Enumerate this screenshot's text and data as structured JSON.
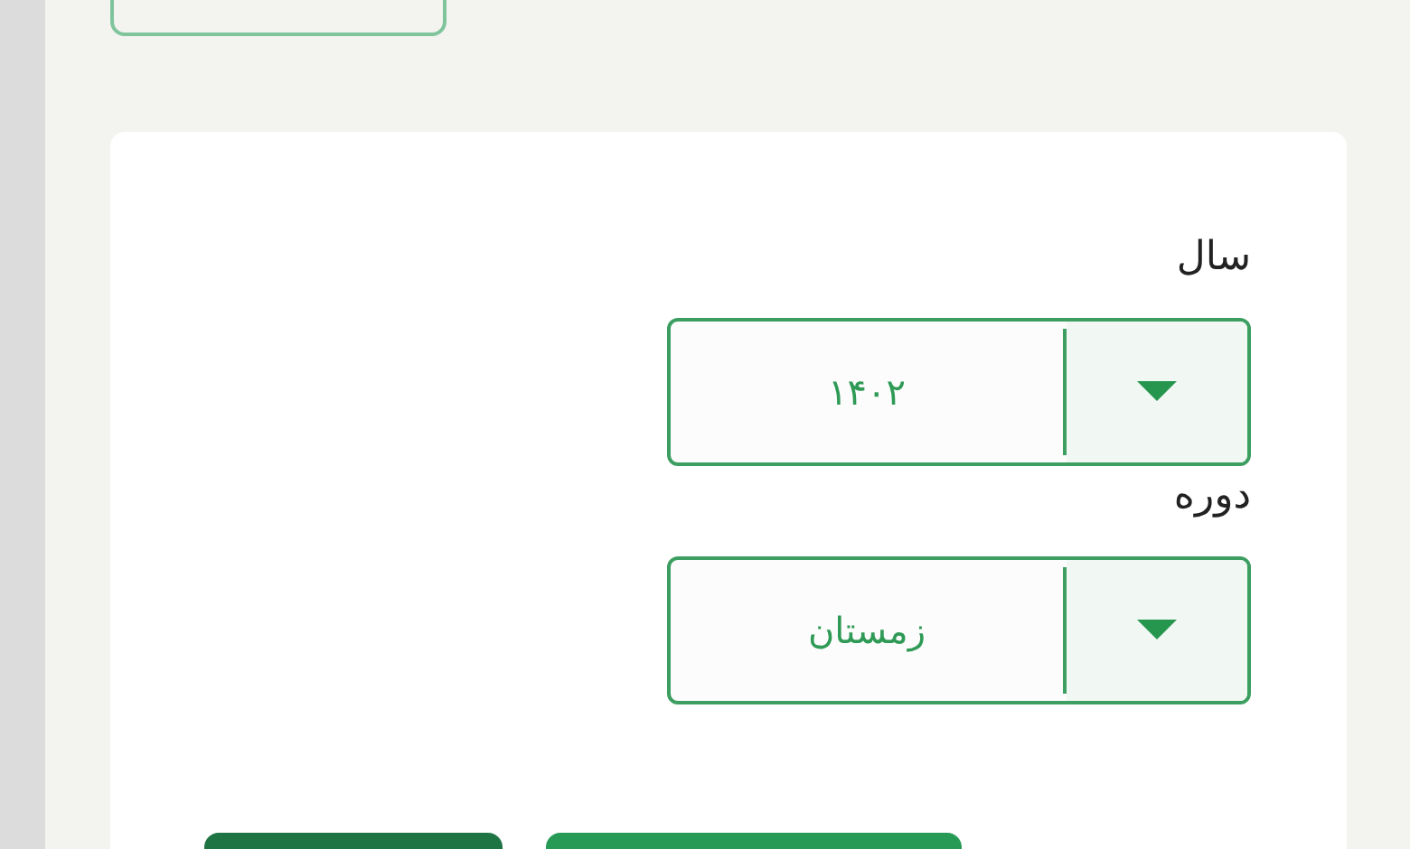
{
  "top_box": {
    "kind": "outline"
  },
  "fields": [
    {
      "label": "سال",
      "value": "۱۴۰۲"
    },
    {
      "label": "دوره",
      "value": "زمستان"
    }
  ],
  "buttons": [
    {
      "kind": "secondary"
    },
    {
      "kind": "primary"
    }
  ]
}
